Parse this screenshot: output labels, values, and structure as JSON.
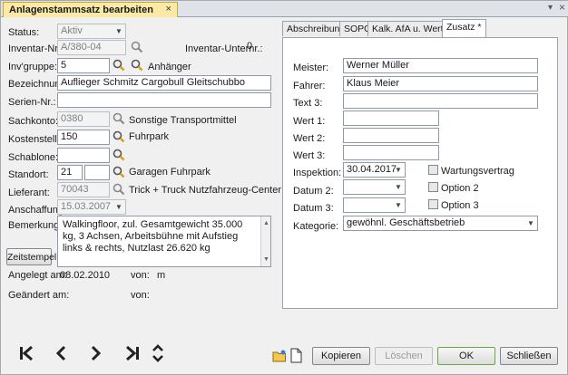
{
  "window": {
    "tab_title": "Anlagenstammsatz bearbeiten",
    "tab_close": "×",
    "close": "×",
    "menu_arrow": "▾"
  },
  "form": {
    "status": {
      "label": "Status:",
      "value": "Aktiv"
    },
    "inventar_nr": {
      "label": "Inventar-Nr.:",
      "value": "A/380-04"
    },
    "inventar_unternr": {
      "label": "Inventar-Unternr.:",
      "value": "0"
    },
    "inv_gruppe": {
      "label": "Inv'gruppe:",
      "value": "5",
      "lookup": "Anhänger"
    },
    "bezeichnung": {
      "label": "Bezeichnung:",
      "value": "Auflieger Schmitz Cargobull Gleitschubbo"
    },
    "serien_nr": {
      "label": "Serien-Nr.:",
      "value": ""
    },
    "sachkonto": {
      "label": "Sachkonto:",
      "value": "0380",
      "lookup": "Sonstige Transportmittel"
    },
    "kostenstelle": {
      "label": "Kostenstelle:",
      "value": "150",
      "lookup": "Fuhrpark"
    },
    "schablone": {
      "label": "Schablone:",
      "value": ""
    },
    "standort": {
      "label": "Standort:",
      "value": "21",
      "value2": "",
      "lookup": "Garagen Fuhrpark"
    },
    "lieferant": {
      "label": "Lieferant:",
      "value": "70043",
      "lookup": "Trick + Truck  Nutzfahrzeug-Center GmbH"
    },
    "anschaffung": {
      "label": "Anschaffung:",
      "value": "15.03.2007"
    },
    "bemerkung": {
      "label": "Bemerkung:",
      "value": "Walkingfloor, zul. Gesamtgewicht 35.000 kg, 3 Achsen, Arbeitsbühne mit Aufstieg links & rechts, Nutzlast 26.620 kg"
    },
    "zeitstempel": "Zeitstempel",
    "angelegt": {
      "label": "Angelegt am:",
      "value": "08.02.2010",
      "von_label": "von:",
      "von_value": "m"
    },
    "geaendert": {
      "label": "Geändert am:",
      "value": "",
      "von_label": "von:",
      "von_value": ""
    }
  },
  "right_tabs": [
    "Abschreibung",
    "SOPO",
    "Kalk. AfA u. Werte *",
    "Zusatz *"
  ],
  "zusatz": {
    "meister": {
      "label": "Meister:",
      "value": "Werner Müller"
    },
    "fahrer": {
      "label": "Fahrer:",
      "value": "Klaus Meier"
    },
    "text3": {
      "label": "Text 3:",
      "value": ""
    },
    "wert1": {
      "label": "Wert 1:",
      "value": ""
    },
    "wert2": {
      "label": "Wert 2:",
      "value": ""
    },
    "wert3": {
      "label": "Wert 3:",
      "value": ""
    },
    "inspektion": {
      "label": "Inspektion:",
      "value": "30.04.2017"
    },
    "datum2": {
      "label": "Datum 2:",
      "value": ""
    },
    "datum3": {
      "label": "Datum 3:",
      "value": ""
    },
    "kategorie": {
      "label": "Kategorie:",
      "value": "gewöhnl. Geschäftsbetrieb"
    },
    "wartungsvertrag": "Wartungsvertrag",
    "option2": "Option 2",
    "option3": "Option 3"
  },
  "footer": {
    "nav": {
      "first": "K",
      "prev": "‹",
      "next": "›",
      "last": "›I"
    },
    "buttons": {
      "kopieren": "Kopieren",
      "loeschen": "Löschen",
      "ok": "OK",
      "schliessen": "Schließen"
    }
  },
  "colors": {
    "tab_active": "#fbe9a6",
    "ok_border": "#6aa842"
  },
  "icons": [
    "search-icon",
    "new-folder-icon",
    "new-document-icon",
    "first-record-icon",
    "previous-record-icon",
    "next-record-icon",
    "last-record-icon",
    "up-down-icon",
    "dropdown-arrow-icon"
  ]
}
